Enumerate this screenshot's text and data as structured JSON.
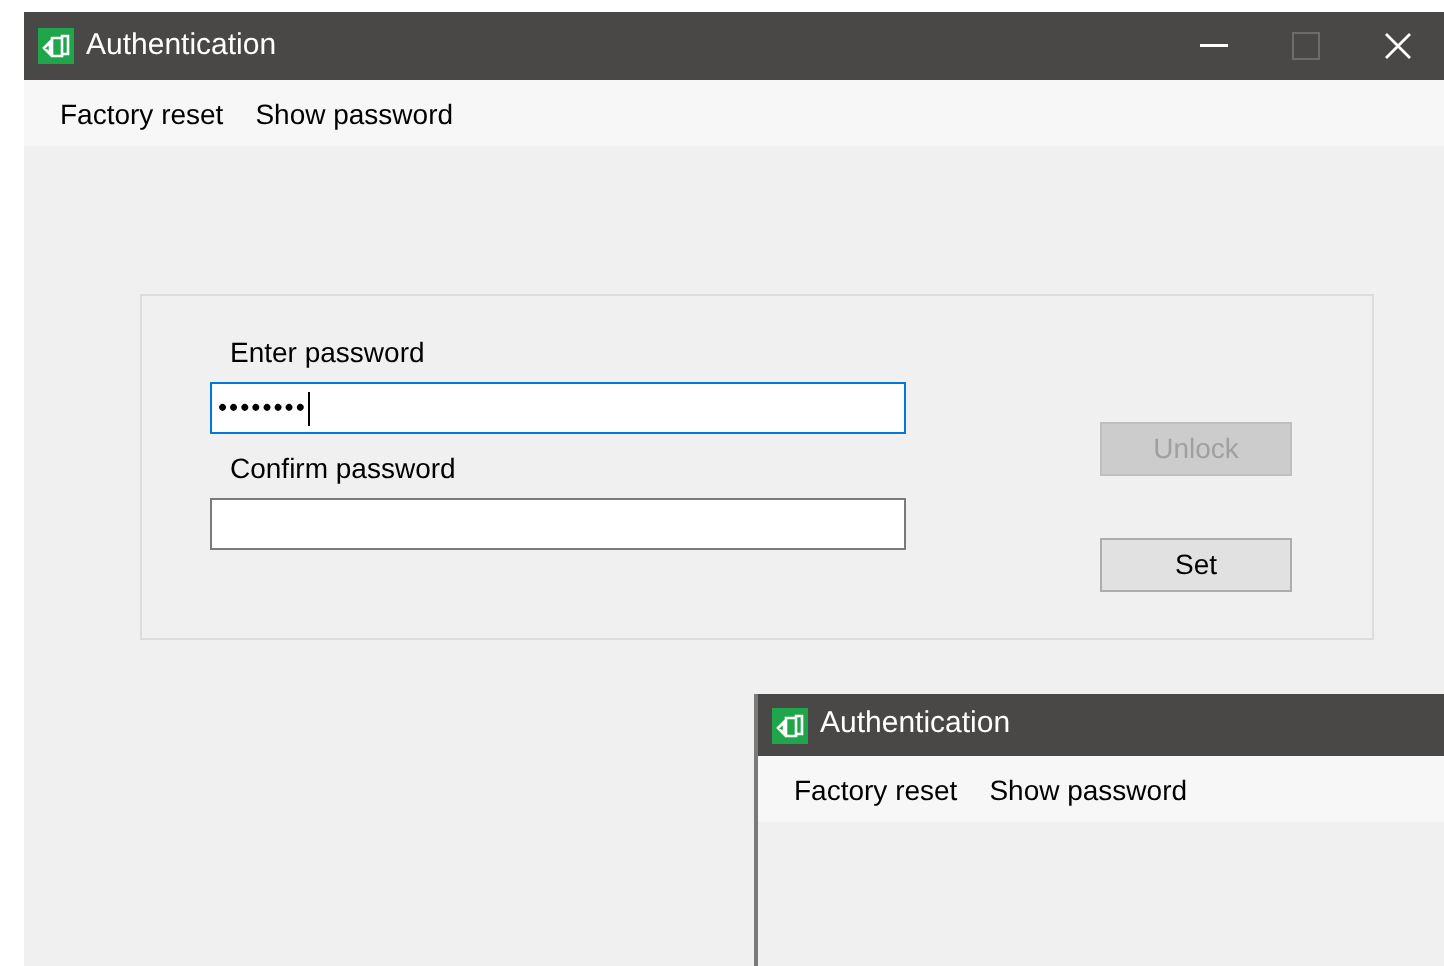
{
  "main_window": {
    "title": "Authentication",
    "menu": [
      {
        "label": "Factory reset"
      },
      {
        "label": "Show password"
      }
    ],
    "fields": [
      {
        "label": "Enter password",
        "value": "••••••••",
        "focused": true
      },
      {
        "label": "Confirm password",
        "focused": false
      }
    ],
    "buttons": [
      {
        "label": "Unlock",
        "disabled": true
      },
      {
        "label": "Set",
        "disabled": false
      }
    ]
  },
  "second_window": {
    "title": "Authentication",
    "menu": [
      {
        "label": "Factory reset"
      },
      {
        "label": "Show password"
      }
    ]
  }
}
